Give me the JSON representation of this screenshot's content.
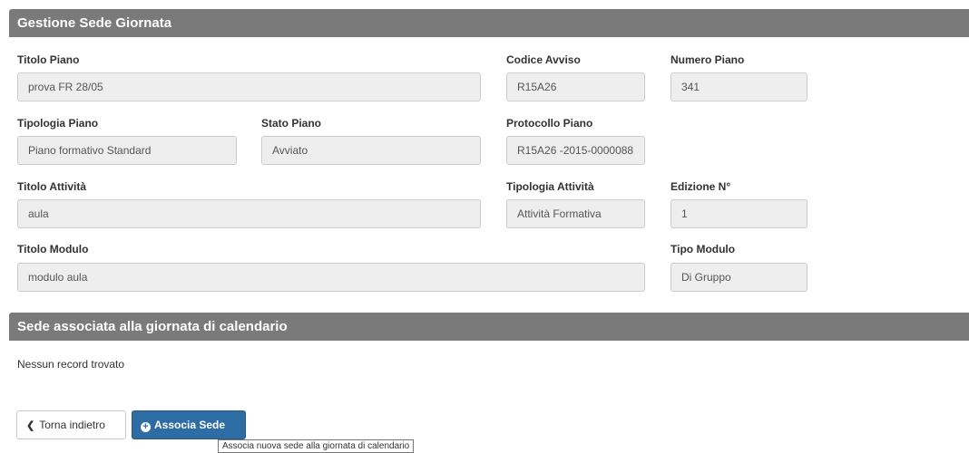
{
  "panel": {
    "title": "Gestione Sede Giornata"
  },
  "fields": {
    "titolo_piano": {
      "label": "Titolo Piano",
      "value": "prova FR 28/05"
    },
    "codice_avviso": {
      "label": "Codice Avviso",
      "value": "R15A26"
    },
    "numero_piano": {
      "label": "Numero Piano",
      "value": "341"
    },
    "tipologia_piano": {
      "label": "Tipologia Piano",
      "value": "Piano formativo Standard"
    },
    "stato_piano": {
      "label": "Stato Piano",
      "value": "Avviato"
    },
    "protocollo_piano": {
      "label": "Protocollo Piano",
      "value": "R15A26 -2015-0000088"
    },
    "titolo_attivita": {
      "label": "Titolo Attività",
      "value": "aula"
    },
    "tipologia_attivita": {
      "label": "Tipologia Attività",
      "value": "Attività Formativa"
    },
    "edizione": {
      "label": "Edizione N°",
      "value": "1"
    },
    "titolo_modulo": {
      "label": "Titolo Modulo",
      "value": "modulo aula"
    },
    "tipo_modulo": {
      "label": "Tipo Modulo",
      "value": "Di Gruppo"
    }
  },
  "sede_section": {
    "title": "Sede associata alla giornata di calendario",
    "empty_message": "Nessun record trovato"
  },
  "buttons": {
    "back_label": "Torna indietro",
    "back_icon": "chevron-left-icon",
    "assoc_label": "Associa Sede",
    "assoc_icon": "plus-circle-icon"
  },
  "tooltip": {
    "text": "Associa nuova sede alla giornata di calendario"
  },
  "colors": {
    "header_bg": "#7a7a7a",
    "primary_button": "#2e6da4",
    "field_bg": "#eeeeee"
  }
}
